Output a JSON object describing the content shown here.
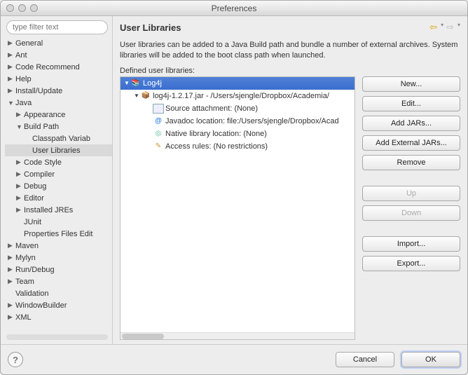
{
  "window": {
    "title": "Preferences"
  },
  "filter": {
    "placeholder": "type filter text"
  },
  "tree": {
    "items": [
      {
        "label": "General",
        "depth": 0,
        "arrow": "▶"
      },
      {
        "label": "Ant",
        "depth": 0,
        "arrow": "▶"
      },
      {
        "label": "Code Recommend",
        "depth": 0,
        "arrow": "▶"
      },
      {
        "label": "Help",
        "depth": 0,
        "arrow": "▶"
      },
      {
        "label": "Install/Update",
        "depth": 0,
        "arrow": "▶"
      },
      {
        "label": "Java",
        "depth": 0,
        "arrow": "▼"
      },
      {
        "label": "Appearance",
        "depth": 1,
        "arrow": "▶"
      },
      {
        "label": "Build Path",
        "depth": 1,
        "arrow": "▼"
      },
      {
        "label": "Classpath Variab",
        "depth": 2,
        "arrow": ""
      },
      {
        "label": "User Libraries",
        "depth": 2,
        "arrow": "",
        "selected": true
      },
      {
        "label": "Code Style",
        "depth": 1,
        "arrow": "▶"
      },
      {
        "label": "Compiler",
        "depth": 1,
        "arrow": "▶"
      },
      {
        "label": "Debug",
        "depth": 1,
        "arrow": "▶"
      },
      {
        "label": "Editor",
        "depth": 1,
        "arrow": "▶"
      },
      {
        "label": "Installed JREs",
        "depth": 1,
        "arrow": "▶"
      },
      {
        "label": "JUnit",
        "depth": 1,
        "arrow": ""
      },
      {
        "label": "Properties Files Edit",
        "depth": 1,
        "arrow": ""
      },
      {
        "label": "Maven",
        "depth": 0,
        "arrow": "▶"
      },
      {
        "label": "Mylyn",
        "depth": 0,
        "arrow": "▶"
      },
      {
        "label": "Run/Debug",
        "depth": 0,
        "arrow": "▶"
      },
      {
        "label": "Team",
        "depth": 0,
        "arrow": "▶"
      },
      {
        "label": "Validation",
        "depth": 0,
        "arrow": ""
      },
      {
        "label": "WindowBuilder",
        "depth": 0,
        "arrow": "▶"
      },
      {
        "label": "XML",
        "depth": 0,
        "arrow": "▶"
      }
    ]
  },
  "page": {
    "heading": "User Libraries",
    "desc": "User libraries can be added to a Java Build path and bundle a number of external archives. System libraries will be added to the boot class path when launched.",
    "definedLabel": "Defined user libraries:",
    "rows": [
      {
        "icon": "ic-lib",
        "label": "Log4j",
        "cls": "root",
        "pad": "pad0",
        "tw": "▼"
      },
      {
        "icon": "ic-jar",
        "label": "log4j-1.2.17.jar - /Users/sjengle/Dropbox/Academia/",
        "pad": "pad1",
        "tw": "▼"
      },
      {
        "icon": "ic-src",
        "label": "Source attachment: (None)",
        "pad": "pad2",
        "tw": ""
      },
      {
        "icon": "ic-jd",
        "label": "Javadoc location: file:/Users/sjengle/Dropbox/Acad",
        "pad": "pad2",
        "tw": ""
      },
      {
        "icon": "ic-nat",
        "label": "Native library location: (None)",
        "pad": "pad2",
        "tw": ""
      },
      {
        "icon": "ic-acc",
        "label": "Access rules: (No restrictions)",
        "pad": "pad2",
        "tw": ""
      }
    ]
  },
  "buttons": {
    "new": "New...",
    "edit": "Edit...",
    "addJars": "Add JARs...",
    "addExt": "Add External JARs...",
    "remove": "Remove",
    "up": "Up",
    "down": "Down",
    "import": "Import...",
    "export": "Export...",
    "cancel": "Cancel",
    "ok": "OK"
  }
}
